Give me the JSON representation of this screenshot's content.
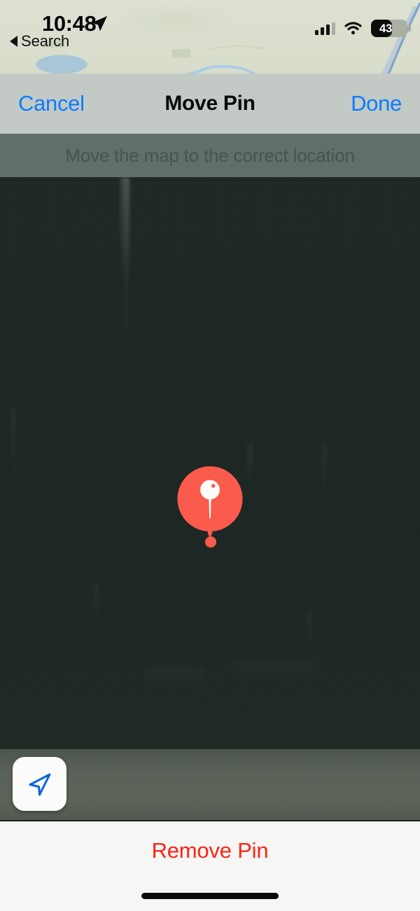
{
  "status_bar": {
    "time": "10:48",
    "location_arrow_icon": "location-arrow-icon",
    "back_app_label": "Search",
    "back_triangle_icon": "back-triangle-icon",
    "cellular_icon": "cellular-bars-icon",
    "cellular_bars_filled": 3,
    "cellular_bars_total": 4,
    "wifi_icon": "wifi-icon",
    "battery_icon": "battery-icon",
    "battery_percent": "43"
  },
  "nav_bar": {
    "cancel_label": "Cancel",
    "title": "Move Pin",
    "done_label": "Done"
  },
  "instruction_banner": {
    "text": "Move the map to the correct location"
  },
  "map": {
    "pin_icon": "map-pin-icon",
    "pin_dot_icon": "pin-anchor-dot-icon",
    "locate_button_icon": "navigation-arrow-icon"
  },
  "bottom_panel": {
    "remove_pin_label": "Remove Pin",
    "home_indicator": "home-indicator"
  },
  "colors": {
    "ios_blue": "#0a7cff",
    "destructive_red": "#ff2316",
    "pin_red": "#fa5b4c",
    "navbar_bg": "#c3c9c5",
    "instruction_bg": "#626e6b",
    "panel_bg": "#f6f6f4"
  }
}
